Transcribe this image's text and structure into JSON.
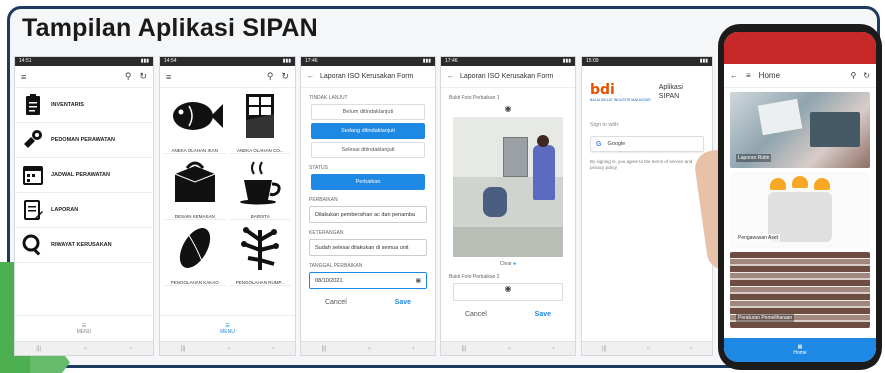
{
  "slide": {
    "title": "Tampilan Aplikasi SIPAN"
  },
  "screen1": {
    "status": "14:51",
    "menu_items": [
      "INVENTARIS",
      "PEDOMAN PERAWATAN",
      "JADWAL PERAWATAN",
      "LAPORAN",
      "RIWAYAT KERUSAKAN"
    ],
    "bottom_label": "MENU"
  },
  "screen2": {
    "status": "14:54",
    "tiles": [
      "ANEKA OLAHAN IKAN",
      "ANEKA OLAHAN CO...",
      "DESAIN KEMASAN",
      "BARISTA",
      "PENGOLAHAN KAKAO",
      "PENGOLAHAN RUMP..."
    ],
    "bottom_label": "MENU"
  },
  "screen3": {
    "status": "17:46",
    "header": "Laporan ISO Kerusakan Form",
    "label_tindak": "TINDAK LANJUT",
    "options": [
      "Belum ditindaklanjuti",
      "Sedang ditindaklanjuti",
      "Selesai ditindaklanjuti"
    ],
    "label_status": "STATUS",
    "status_value": "Perbaikan",
    "label_perbaikan": "PERBAIKAN",
    "perbaikan_value": "Dilakukan pembersihan ac dan penamba",
    "label_keterangan": "KETERANGAN",
    "keterangan_value": "Sudah selesai dilakukan di semua unit",
    "label_tanggal": "TANGGAL PERBAIKAN",
    "tanggal_value": "08/10/2021",
    "cancel": "Cancel",
    "save": "Save"
  },
  "screen4": {
    "status": "17:46",
    "header": "Laporan ISO Kerusakan Form",
    "label_photo1": "Bukti Foto Perbaikan 1",
    "clear": "Clear",
    "label_photo2": "Bukti Foto Perbaikan 2",
    "cancel": "Cancel",
    "save": "Save"
  },
  "screen5": {
    "status": "15:09",
    "logo": "bdi",
    "logo_sub": "BALAI DIKLAT INDUSTRI MAKASSAR",
    "app_line1": "Aplikasi",
    "app_line2": "SIPAN",
    "signin": "Sign in with:",
    "google": "Google",
    "terms": "By signing in, you agree to the terms of service and privacy policy"
  },
  "phone": {
    "title": "Home",
    "cards": [
      "Laporan Rutin",
      "Pengawasan Aset",
      "Peraturan Pemeliharaan"
    ],
    "nav_label": "Home"
  },
  "colors": {
    "accent": "#1e88e5",
    "frame": "#1e3a5f",
    "red": "#c62828"
  }
}
